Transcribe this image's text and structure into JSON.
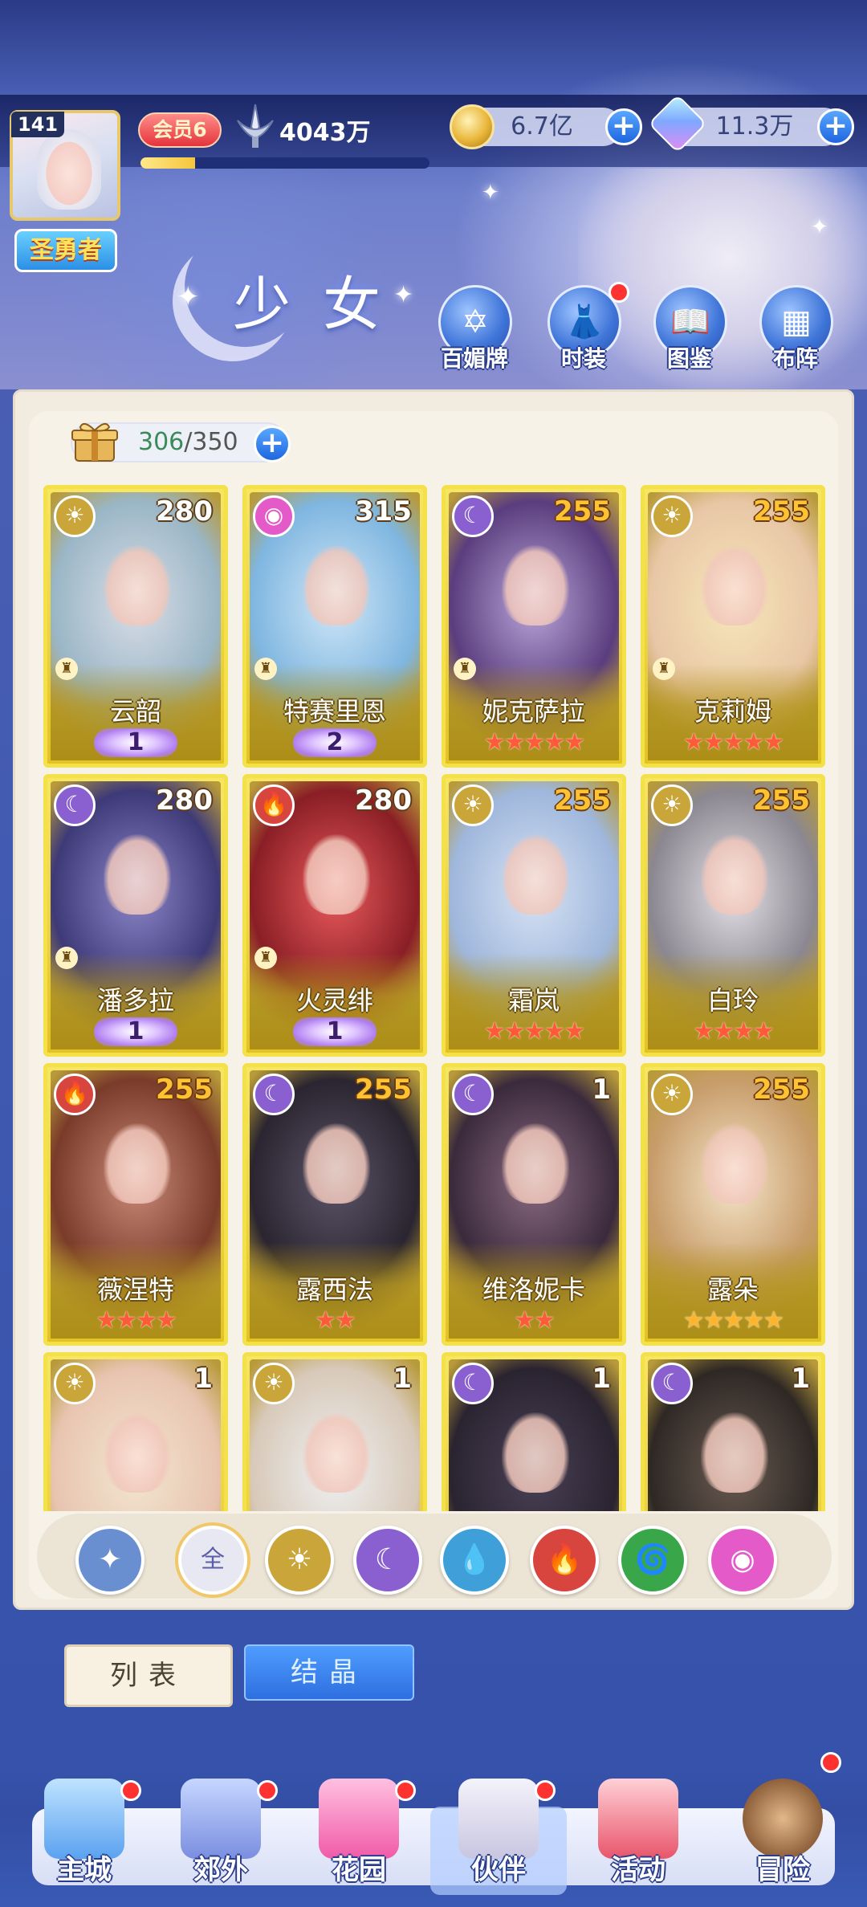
{
  "header": {
    "level": "141",
    "player_title": "圣勇者",
    "vip_label": "会员6",
    "vip_progress": 0.19,
    "power": "4043万",
    "gold": "6.7亿",
    "gems": "11.3万",
    "plus_symbol": "+"
  },
  "page": {
    "title": "少女",
    "features": [
      {
        "label": "百媚牌",
        "icon": "card-deck-icon",
        "glyph": "✡",
        "badge": false
      },
      {
        "label": "时装",
        "icon": "costume-icon",
        "glyph": "👗",
        "badge": true
      },
      {
        "label": "图鉴",
        "icon": "book-icon",
        "glyph": "📖",
        "badge": false
      },
      {
        "label": "布阵",
        "icon": "formation-grid-icon",
        "glyph": "▦",
        "badge": false
      }
    ]
  },
  "roster": {
    "count_current": "306",
    "count_separator": "/",
    "count_max": "350",
    "cards": [
      {
        "name": "云韶",
        "level": "280",
        "element": "sun",
        "rank_type": "wing",
        "rank": "1",
        "colors": [
          "#d9dde6",
          "#9ab6c6"
        ]
      },
      {
        "name": "特赛里恩",
        "level": "315",
        "element": "pink",
        "rank_type": "wing",
        "rank": "2",
        "colors": [
          "#cfe6f7",
          "#7fb6e0"
        ]
      },
      {
        "name": "妮克萨拉",
        "level": "255",
        "element": "moon",
        "rank_type": "stars",
        "stars": "★★★★★",
        "colors": [
          "#b9a6d8",
          "#5a3d7e"
        ]
      },
      {
        "name": "克莉姆",
        "level": "255",
        "element": "sun",
        "rank_type": "stars",
        "stars": "★★★★★",
        "colors": [
          "#f6e7b9",
          "#e8c6a6"
        ]
      },
      {
        "name": "潘多拉",
        "level": "280",
        "element": "moon",
        "rank_type": "wing",
        "rank": "1",
        "colors": [
          "#8c86c8",
          "#3e3a78"
        ]
      },
      {
        "name": "火灵绯",
        "level": "280",
        "element": "fire",
        "rank_type": "wing",
        "rank": "1",
        "colors": [
          "#e85a5a",
          "#8a1e26"
        ]
      },
      {
        "name": "霜岚",
        "level": "255",
        "element": "sun",
        "rank_type": "stars",
        "stars": "★★★★★",
        "colors": [
          "#d6e2f3",
          "#9fb7dc"
        ]
      },
      {
        "name": "白玲",
        "level": "255",
        "element": "sun",
        "rank_type": "stars",
        "stars": "★★★★",
        "colors": [
          "#e3e0e6",
          "#8b8790"
        ]
      },
      {
        "name": "薇涅特",
        "level": "255",
        "element": "fire",
        "rank_type": "stars",
        "stars": "★★★★",
        "colors": [
          "#c98a78",
          "#7a3b2a"
        ]
      },
      {
        "name": "露西法",
        "level": "255",
        "element": "moon",
        "rank_type": "stars",
        "stars": "★★",
        "colors": [
          "#5b5468",
          "#2a2530"
        ]
      },
      {
        "name": "维洛妮卡",
        "level": "1",
        "element": "moon",
        "rank_type": "stars",
        "stars": "★★",
        "colors": [
          "#8a6a80",
          "#3a2a3c"
        ]
      },
      {
        "name": "露朵",
        "level": "255",
        "element": "sun",
        "rank_type": "stars",
        "stars": "★★★★★",
        "star_color": "gold",
        "colors": [
          "#f4e4c8",
          "#c79c6a"
        ]
      },
      {
        "name": "",
        "level": "1",
        "element": "sun",
        "rank_type": "none",
        "colors": [
          "#f2e6d0",
          "#e8c4b0"
        ]
      },
      {
        "name": "",
        "level": "1",
        "element": "sun",
        "rank_type": "none",
        "colors": [
          "#eef0f2",
          "#d8c9b9"
        ]
      },
      {
        "name": "",
        "level": "1",
        "element": "moon",
        "rank_type": "none",
        "colors": [
          "#4a4256",
          "#2a2330"
        ]
      },
      {
        "name": "",
        "level": "1",
        "element": "moon",
        "rank_type": "none",
        "colors": [
          "#6a5a52",
          "#2e2824"
        ]
      }
    ]
  },
  "element_filters": [
    {
      "name": "wind-wing-filter",
      "glyph": "✦",
      "color": "#6a8fd0"
    },
    {
      "name": "all-filter",
      "glyph": "全",
      "color": "#e8e8f2",
      "text_color": "#5a5fa8",
      "selected": true
    },
    {
      "name": "sun-filter",
      "glyph": "☀",
      "color": "#c9a53a"
    },
    {
      "name": "moon-filter",
      "glyph": "☾",
      "color": "#8a5fd0"
    },
    {
      "name": "water-filter",
      "glyph": "💧",
      "color": "#3f9fd8"
    },
    {
      "name": "fire-filter",
      "glyph": "🔥",
      "color": "#d8443e"
    },
    {
      "name": "wind-filter",
      "glyph": "🌀",
      "color": "#3aa64a"
    },
    {
      "name": "pink-orb-filter",
      "glyph": "◉",
      "color": "#e45ac8"
    }
  ],
  "tabs": {
    "list": "列表",
    "crystal": "结晶"
  },
  "nav": [
    {
      "label": "主城",
      "icon": "castle-icon",
      "badge": true
    },
    {
      "label": "郊外",
      "icon": "portal-icon",
      "badge": true
    },
    {
      "label": "花园",
      "icon": "heart-icon",
      "badge": true
    },
    {
      "label": "伙伴",
      "icon": "partner-icon",
      "badge": true,
      "active": true
    },
    {
      "label": "活动",
      "icon": "gift-icon",
      "badge": false
    },
    {
      "label": "冒险",
      "icon": "compass-icon",
      "badge": true
    }
  ],
  "element_colors": {
    "sun": "#c9a53a",
    "moon": "#8a5fd0",
    "fire": "#d8443e",
    "pink": "#e45ac8"
  },
  "element_glyphs": {
    "sun": "☀",
    "moon": "☾",
    "fire": "🔥",
    "pink": "◉"
  }
}
